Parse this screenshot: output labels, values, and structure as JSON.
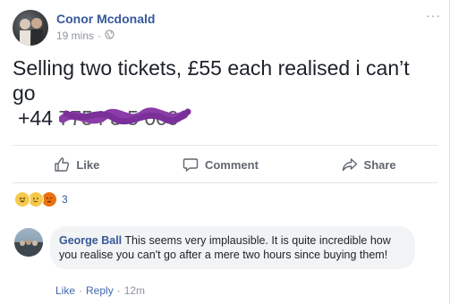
{
  "post": {
    "author": "Conor Mcdonald",
    "time": "19 mins",
    "meta_separator": "·",
    "privacy_icon": "globe-icon",
    "more_icon": "more-options-icon",
    "more_label": "···",
    "text": "Selling two tickets, £55 each realised i can’t go",
    "phone_prefix": "+44",
    "phone_redacted": "7754 3 5 000"
  },
  "actions": {
    "like_label": "Like",
    "comment_label": "Comment",
    "share_label": "Share"
  },
  "reactions": {
    "types": [
      "haha",
      "sad",
      "angry"
    ],
    "count": "3"
  },
  "comment": {
    "author": "George Ball",
    "text": "This seems very implausible. It is quite incredible how you realise you can't go after a mere two hours since buying them!",
    "like_label": "Like",
    "separator": "·",
    "reply_label": "Reply",
    "time": "12m"
  },
  "colors": {
    "link_blue": "#365899",
    "action_gray": "#606770",
    "meta_gray": "#90949c",
    "scribble_purple": "#8a3da8",
    "bubble_bg": "#f2f3f5"
  }
}
